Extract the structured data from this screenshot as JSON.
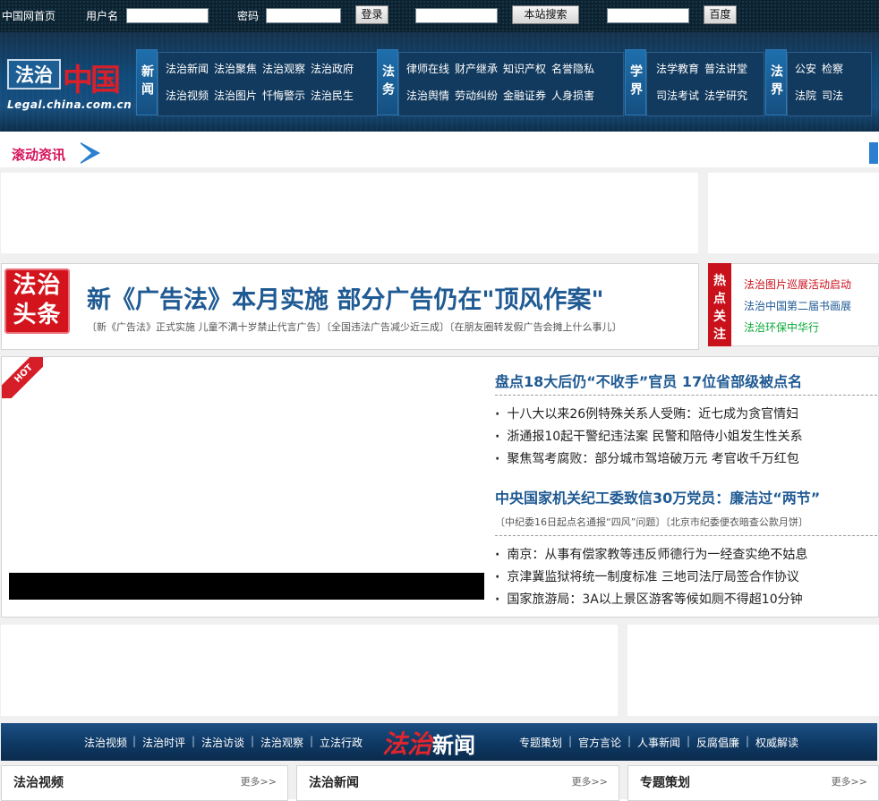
{
  "topbar": {
    "home": "中国网首页",
    "username_label": "用户名",
    "password_label": "密码",
    "login_button": "登录",
    "site_search_button": "本站搜索",
    "baidu_button": "百度"
  },
  "logo": {
    "box_text": "法治",
    "cn_text": "中国",
    "domain": "Legal.china.com.cn"
  },
  "nav": [
    {
      "label": "新闻",
      "links": [
        "法治新闻",
        "法治聚焦",
        "法治观察",
        "法治政府",
        "法治视频",
        "法治图片",
        "忏悔警示",
        "法治民生"
      ]
    },
    {
      "label": "法务",
      "links": [
        "律师在线",
        "财产继承",
        "知识产权",
        "名誉隐私",
        "法治舆情",
        "劳动纠纷",
        "金融证券",
        "人身损害"
      ]
    },
    {
      "label": "学界",
      "links": [
        "法学教育",
        "普法讲堂",
        "司法考试",
        "法学研究"
      ]
    },
    {
      "label": "法界",
      "links": [
        "公安",
        "检察",
        "法院",
        "司法"
      ]
    }
  ],
  "scroll": {
    "label": "滚动资讯"
  },
  "headline": {
    "stamp": "法治头条",
    "title": "新《广告法》本月实施 部分广告仍在\"顶风作案\"",
    "subs": "〔新《广告法》正式实施 儿童不满十岁禁止代言广告〕〔全国违法广告减少近三成〕〔在朋友圈转发假广告会摊上什么事儿〕"
  },
  "hot": {
    "label": "热点关注",
    "items": [
      {
        "text": "法治图片巡展活动启动",
        "color": "#c9111b"
      },
      {
        "text": "法治中国第二届书画展",
        "color": "#1f5a93"
      },
      {
        "text": "法治环保中华行",
        "color": "#0aa838"
      }
    ]
  },
  "main": {
    "hot_ribbon": "HOT",
    "block1_title": "盘点18大后仍“不收手”官员  17位省部级被点名",
    "block1_items": [
      "十八大以来26例特殊关系人受贿：近七成为贪官情妇",
      "浙通报10起干警纪违法案 民警和陪侍小姐发生性关系",
      "聚焦驾考腐败：部分城市驾培破万元 考官收千万红包"
    ],
    "block2_title": "中央国家机关纪工委致信30万党员：廉洁过“两节”",
    "block2_sub": "〔中纪委16日起点名通报“四风”问题〕〔北京市纪委便衣暗查公款月饼〕",
    "block2_items": [
      "南京：从事有偿家教等违反师德行为一经查实绝不姑息",
      "京津冀监狱将统一制度标准 三地司法厅局签合作协议",
      "国家旅游局：3A以上景区游客等候如厕不得超10分钟"
    ]
  },
  "bluenav": {
    "left": [
      "法治视频",
      "法治时评",
      "法治访谈",
      "法治观察",
      "立法行政"
    ],
    "logo_red": "法治",
    "logo_white": "新闻",
    "right": [
      "专题策划",
      "官方言论",
      "人事新闻",
      "反腐倡廉",
      "权威解读"
    ]
  },
  "columns": [
    {
      "title": "法治视频",
      "more": "更多>>"
    },
    {
      "title": "法治新闻",
      "more": "更多>>"
    },
    {
      "title": "专题策划",
      "more": "更多>>"
    }
  ]
}
